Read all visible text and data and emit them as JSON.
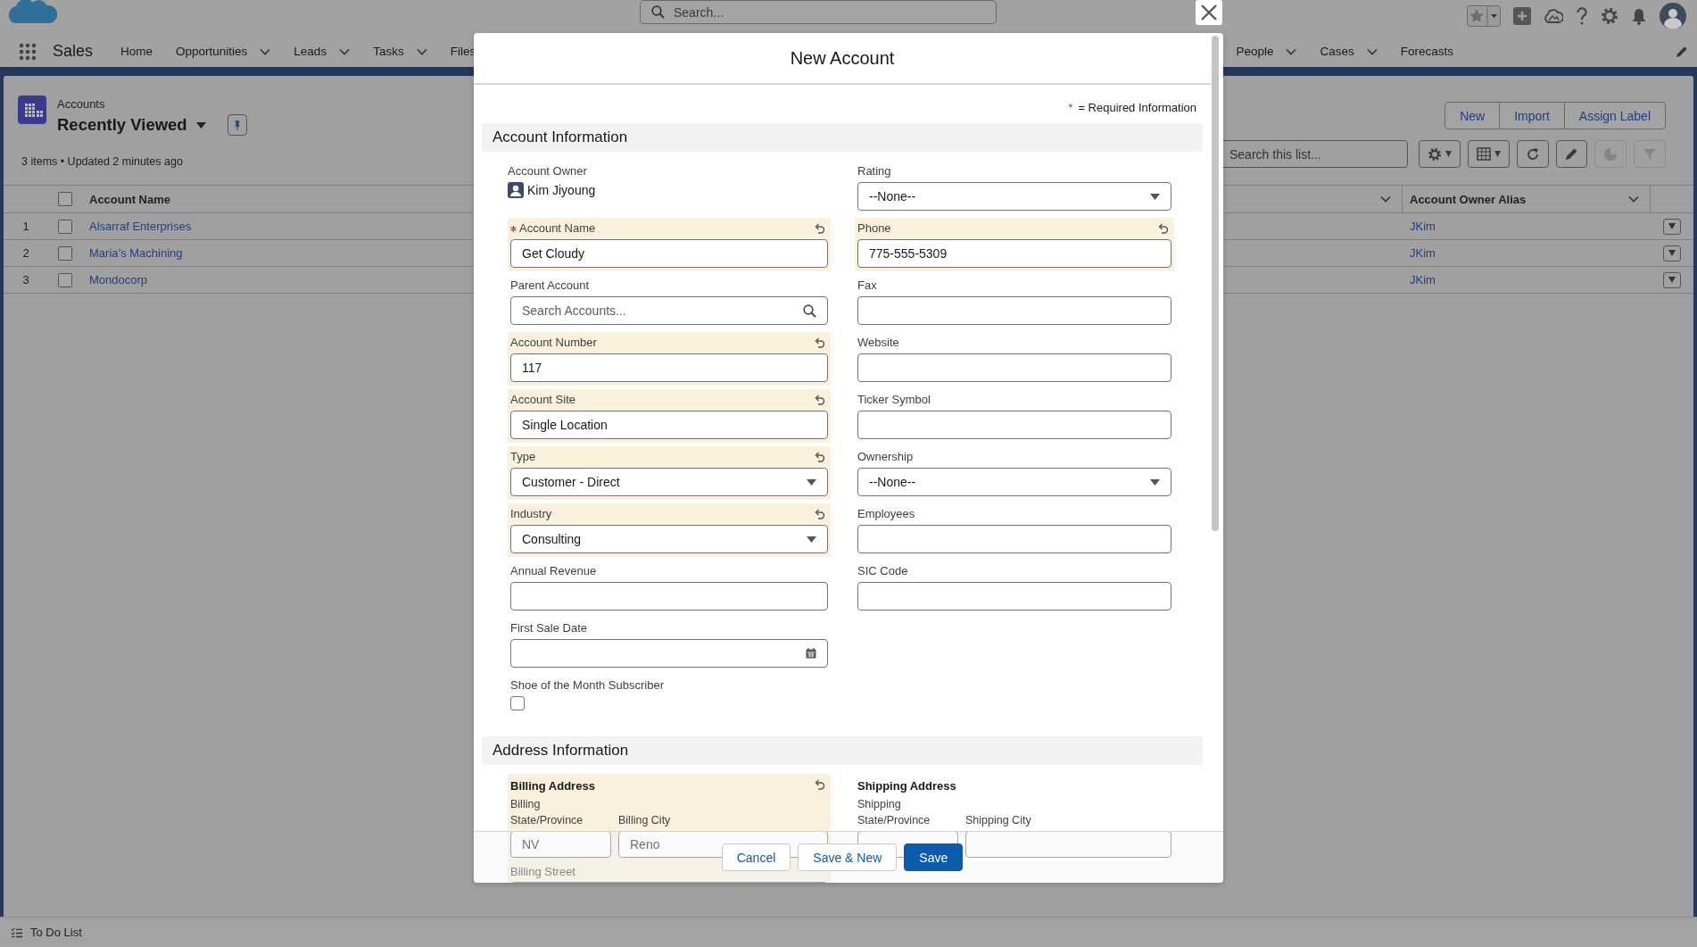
{
  "global_header": {
    "search": {
      "placeholder": "Search..."
    }
  },
  "navigation": {
    "app_name": "Sales",
    "items": [
      {
        "label": "Home",
        "menu": false
      },
      {
        "label": "Opportunities",
        "menu": true
      },
      {
        "label": "Leads",
        "menu": true
      },
      {
        "label": "Tasks",
        "menu": true
      },
      {
        "label": "Files",
        "menu": false
      }
    ],
    "items_right": [
      {
        "label": "People",
        "menu": true
      },
      {
        "label": "Cases",
        "menu": true
      },
      {
        "label": "Forecasts",
        "menu": false
      }
    ]
  },
  "list_view": {
    "object": "Accounts",
    "title": "Recently Viewed",
    "status": "3 items • Updated 2 minutes ago",
    "actions": [
      "New",
      "Import",
      "Assign Label"
    ],
    "search": {
      "placeholder": "Search this list..."
    },
    "tools": [
      {
        "kind": "settings",
        "disabled": false
      },
      {
        "kind": "display",
        "disabled": false
      },
      {
        "kind": "refresh",
        "disabled": false
      },
      {
        "kind": "edit",
        "disabled": false
      },
      {
        "kind": "chart",
        "disabled": true
      },
      {
        "kind": "filter",
        "disabled": true
      }
    ]
  },
  "table": {
    "columns": [
      "Account Name",
      "Account Owner Alias"
    ],
    "all_selected": false,
    "rows": [
      {
        "number": "1",
        "account_name": "Alsarraf Enterprises",
        "owner_alias": "JKim",
        "selected": false
      },
      {
        "number": "2",
        "account_name": "Maria’s Machining",
        "owner_alias": "JKim",
        "selected": false
      },
      {
        "number": "3",
        "account_name": "Mondocorp",
        "owner_alias": "JKim",
        "selected": false
      }
    ]
  },
  "modal": {
    "title": "New Account",
    "required_note": {
      "mark": "*",
      "text": "= Required Information"
    },
    "sections": [
      {
        "title": "Account Information",
        "left": [
          {
            "kind": "owner",
            "label": "Account Owner",
            "value": "Kim Jiyoung",
            "required": false,
            "edited": false
          },
          {
            "kind": "text",
            "label": "Account Name",
            "value": "Get Cloudy",
            "required": true,
            "edited": true
          },
          {
            "kind": "lookup",
            "label": "Parent Account",
            "placeholder": "Search Accounts...",
            "required": false,
            "edited": false
          },
          {
            "kind": "text",
            "label": "Account Number",
            "value": "117",
            "required": false,
            "edited": true
          },
          {
            "kind": "text",
            "label": "Account Site",
            "value": "Single Location",
            "required": false,
            "edited": true
          },
          {
            "kind": "picklist",
            "label": "Type",
            "value": "Customer - Direct",
            "required": false,
            "edited": true
          },
          {
            "kind": "picklist",
            "label": "Industry",
            "value": "Consulting",
            "required": false,
            "edited": true
          },
          {
            "kind": "text",
            "label": "Annual Revenue",
            "required": false,
            "edited": false
          },
          {
            "kind": "date",
            "label": "First Sale Date",
            "required": false,
            "edited": false
          },
          {
            "kind": "checkbox",
            "label": "Shoe of the Month Subscriber",
            "checked": false,
            "required": false,
            "edited": false
          }
        ],
        "right": [
          {
            "kind": "picklist",
            "label": "Rating",
            "value": "--None--",
            "required": false,
            "edited": false
          },
          {
            "kind": "text",
            "label": "Phone",
            "value": "775-555-5309",
            "required": false,
            "edited": true
          },
          {
            "kind": "text",
            "label": "Fax",
            "required": false,
            "edited": false
          },
          {
            "kind": "text",
            "label": "Website",
            "required": false,
            "edited": false
          },
          {
            "kind": "text",
            "label": "Ticker Symbol",
            "required": false,
            "edited": false
          },
          {
            "kind": "picklist",
            "label": "Ownership",
            "value": "--None--",
            "required": false,
            "edited": false
          },
          {
            "kind": "text",
            "label": "Employees",
            "required": false,
            "edited": false
          },
          {
            "kind": "text",
            "label": "SIC Code",
            "required": false,
            "edited": false
          }
        ]
      },
      {
        "title": "Address Information",
        "left": [
          {
            "kind": "address",
            "label": "Billing Address",
            "edited": true,
            "required": false,
            "subfields": [
              {
                "label": "Billing State/Province",
                "value": "NV"
              },
              {
                "label": "Billing City",
                "value": "Reno"
              }
            ],
            "next_label": "Billing Street"
          }
        ],
        "right": [
          {
            "kind": "address",
            "label": "Shipping Address",
            "edited": false,
            "required": false,
            "subfields": [
              {
                "label": "Shipping State/Province"
              },
              {
                "label": "Shipping City"
              }
            ]
          }
        ]
      }
    ],
    "buttons": [
      {
        "label": "Cancel",
        "primary": false
      },
      {
        "label": "Save & New",
        "primary": false
      },
      {
        "label": "Save",
        "primary": true
      }
    ]
  },
  "utility_bar": {
    "items": [
      "To Do List"
    ]
  }
}
